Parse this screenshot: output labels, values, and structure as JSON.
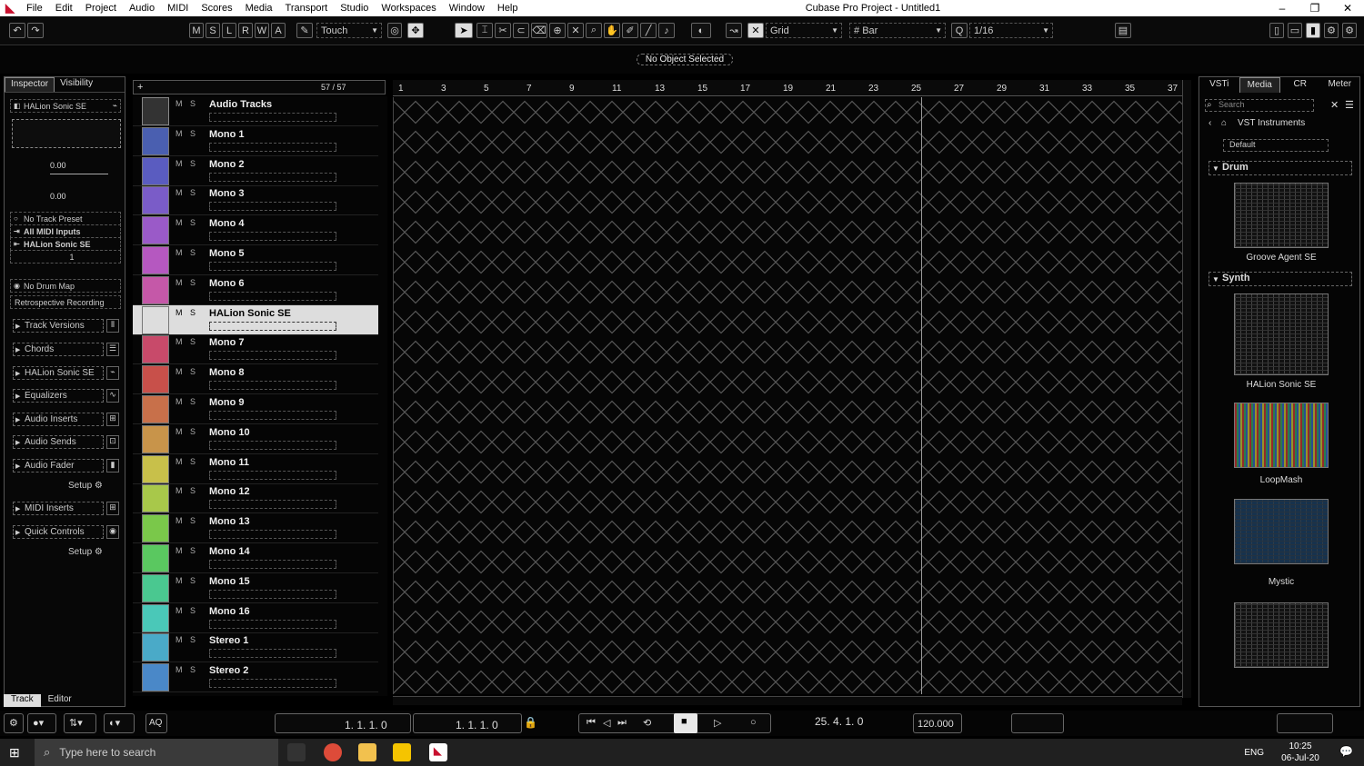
{
  "app": {
    "title": "Cubase Pro Project - Untitled1",
    "menu": [
      "File",
      "Edit",
      "Project",
      "Audio",
      "MIDI",
      "Scores",
      "Media",
      "Transport",
      "Studio",
      "Workspaces",
      "Window",
      "Help"
    ],
    "window_controls": [
      "–",
      "❐",
      "✕"
    ]
  },
  "toolbar": {
    "modes": [
      "M",
      "S",
      "L",
      "R",
      "W",
      "A"
    ],
    "automation_mode": "Touch",
    "snap_type": "Grid",
    "grid_type": "Bar",
    "quantize": "1/16"
  },
  "info_line": {
    "message": "No Object Selected"
  },
  "inspector": {
    "tabs": [
      "Inspector",
      "Visibility"
    ],
    "track_name": "HALion Sonic SE",
    "volume": "0.00",
    "pan": "0.00",
    "track_preset": "No Track Preset",
    "midi_input": "All MIDI Inputs",
    "midi_output": "HALion Sonic SE",
    "channel": "1",
    "drum_map": "No Drum Map",
    "retro": "Retrospective Recording",
    "sections": [
      "Track Versions",
      "Chords",
      "HALion Sonic SE",
      "Equalizers",
      "Audio Inserts",
      "Audio Sends",
      "Audio Fader",
      "MIDI Inserts",
      "Quick Controls"
    ],
    "setup_label": "Setup",
    "bottom_tabs": [
      "Track",
      "Editor"
    ]
  },
  "tracklist": {
    "counter": "57 / 57",
    "tracks": [
      {
        "name": "Audio Tracks",
        "color": "#333333",
        "type": "folder"
      },
      {
        "name": "Mono 1",
        "color": "#4a5fb0",
        "type": "audio"
      },
      {
        "name": "Mono 2",
        "color": "#5a5cc0",
        "type": "audio"
      },
      {
        "name": "Mono 3",
        "color": "#7a5cc8",
        "type": "audio"
      },
      {
        "name": "Mono 4",
        "color": "#9a5ac8",
        "type": "audio"
      },
      {
        "name": "Mono 5",
        "color": "#b558c0",
        "type": "audio"
      },
      {
        "name": "Mono 6",
        "color": "#c558a8",
        "type": "audio"
      },
      {
        "name": "HALion Sonic SE",
        "color": "#dddddd",
        "type": "instrument"
      },
      {
        "name": "Mono 7",
        "color": "#c84a6a",
        "type": "audio"
      },
      {
        "name": "Mono 8",
        "color": "#c8504a",
        "type": "audio"
      },
      {
        "name": "Mono 9",
        "color": "#c8704a",
        "type": "audio"
      },
      {
        "name": "Mono 10",
        "color": "#c8944a",
        "type": "audio"
      },
      {
        "name": "Mono 11",
        "color": "#c8c04a",
        "type": "audio"
      },
      {
        "name": "Mono 12",
        "color": "#a8c84a",
        "type": "audio"
      },
      {
        "name": "Mono 13",
        "color": "#7ac84a",
        "type": "audio"
      },
      {
        "name": "Mono 14",
        "color": "#5ac860",
        "type": "audio"
      },
      {
        "name": "Mono 15",
        "color": "#4ac890",
        "type": "audio"
      },
      {
        "name": "Mono 16",
        "color": "#4ac8b8",
        "type": "audio"
      },
      {
        "name": "Stereo 1",
        "color": "#4aaac8",
        "type": "audio"
      },
      {
        "name": "Stereo 2",
        "color": "#4a88c8",
        "type": "audio"
      }
    ]
  },
  "ruler": {
    "marks": [
      "1",
      "3",
      "5",
      "7",
      "9",
      "11",
      "13",
      "15",
      "17",
      "19",
      "21",
      "23",
      "25",
      "27",
      "29",
      "31",
      "33",
      "35",
      "37"
    ]
  },
  "right_zone": {
    "tabs": [
      "VSTi",
      "Media",
      "CR",
      "Meter"
    ],
    "search_placeholder": "Search",
    "path": "VST Instruments",
    "preset": "Default",
    "categories": [
      {
        "name": "Drum",
        "items": [
          "Groove Agent SE"
        ]
      },
      {
        "name": "Synth",
        "items": [
          "HALion Sonic SE",
          "LoopMash",
          "Mystic"
        ]
      }
    ]
  },
  "transport": {
    "left_locator": "1. 1. 1. 0",
    "right_locator": "1. 1. 1. 0",
    "position": "25. 4. 1. 0",
    "tempo": "120.000"
  },
  "taskbar": {
    "search_placeholder": "Type here to search",
    "language": "ENG",
    "time": "10:25",
    "date": "06-Jul-20"
  }
}
